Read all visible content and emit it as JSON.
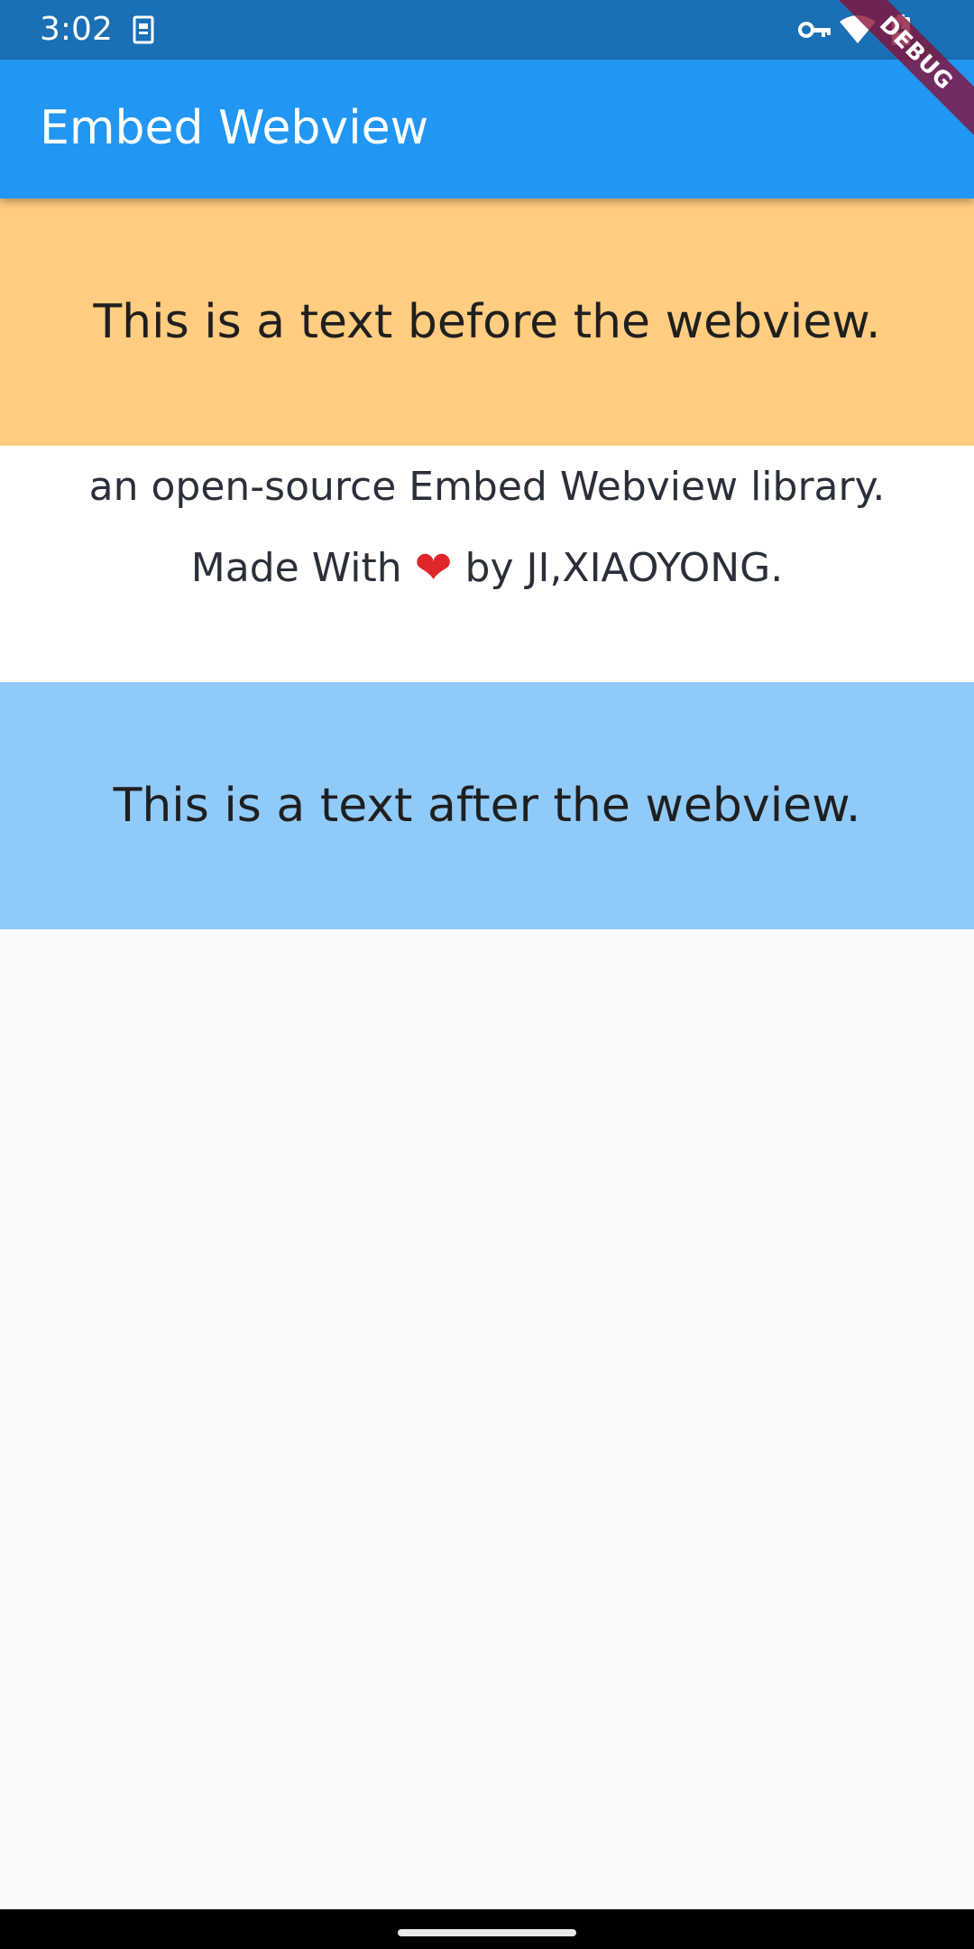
{
  "status_bar": {
    "time": "3:02",
    "icons": [
      "sim-card-icon",
      "vpn-key-icon",
      "wifi-icon",
      "battery-charging-icon"
    ],
    "background": "#1a6fb5"
  },
  "app_bar": {
    "title": "Embed Webview",
    "background": "#2196f3"
  },
  "debug_banner": {
    "label": "DEBUG"
  },
  "content": {
    "before_text": "This is a text before the webview.",
    "before_background": "#ffcc80",
    "webview": {
      "line1": "an open-source Embed Webview library.",
      "line2_prefix": "Made With",
      "heart": "❤",
      "line2_suffix": "by JI,XIAOYONG."
    },
    "after_text": "This is a text after the webview.",
    "after_background": "#90caf9"
  }
}
